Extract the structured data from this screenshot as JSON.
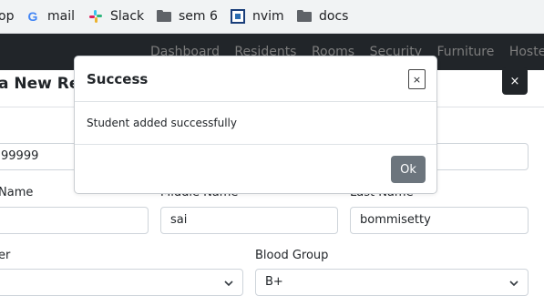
{
  "bookmarks": {
    "partial_label": "op",
    "items": [
      {
        "label": "mail",
        "icon": "google-icon"
      },
      {
        "label": "Slack",
        "icon": "slack-icon"
      },
      {
        "label": "sem 6",
        "icon": "folder-icon"
      },
      {
        "label": "nvim",
        "icon": "nvim-icon"
      },
      {
        "label": "docs",
        "icon": "folder-icon"
      }
    ]
  },
  "navbar": {
    "links": [
      "Dashboard",
      "Residents",
      "Rooms",
      "Security",
      "Furniture",
      "Hostel"
    ]
  },
  "background_modal": {
    "title": "a New Resi",
    "close_label": "×",
    "fields": {
      "phone_value": "99999",
      "first_name_label": "Name",
      "first_name_value": "",
      "middle_name_label": "Middle Name",
      "middle_name_value": "sai",
      "last_name_label": "Last Name",
      "last_name_value": "bommisetty",
      "gender_label": "er",
      "gender_value": "",
      "blood_group_label": "Blood Group",
      "blood_group_value": "B+"
    }
  },
  "dialog": {
    "title": "Success",
    "close_label": "×",
    "message": "Student added successfully",
    "ok_label": "Ok"
  },
  "colors": {
    "navbar_bg": "#212529",
    "ok_button_bg": "#6c757d"
  }
}
